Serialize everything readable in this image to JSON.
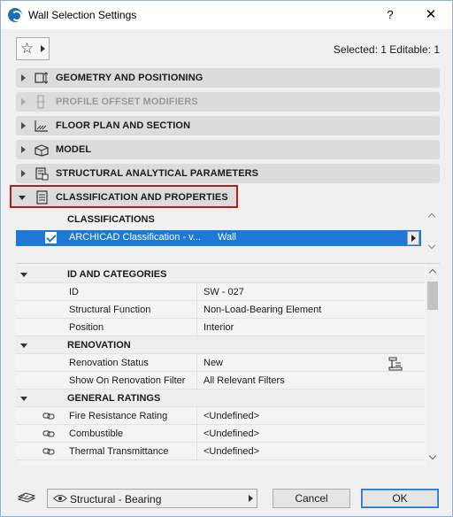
{
  "window": {
    "title": "Wall Selection Settings",
    "help_label": "?",
    "close_label": "✕"
  },
  "toolbar": {
    "selected_info": "Selected: 1 Editable: 1"
  },
  "sections": [
    {
      "label": "GEOMETRY AND POSITIONING",
      "icon": "geometry-icon",
      "disabled": false,
      "open": false
    },
    {
      "label": "PROFILE OFFSET MODIFIERS",
      "icon": "profile-offset-icon",
      "disabled": true,
      "open": false
    },
    {
      "label": "FLOOR PLAN AND SECTION",
      "icon": "floor-plan-icon",
      "disabled": false,
      "open": false
    },
    {
      "label": "MODEL",
      "icon": "model-icon",
      "disabled": false,
      "open": false
    },
    {
      "label": "STRUCTURAL ANALYTICAL PARAMETERS",
      "icon": "structural-analytical-icon",
      "disabled": false,
      "open": false
    },
    {
      "label": "CLASSIFICATION AND PROPERTIES",
      "icon": "classification-icon",
      "disabled": false,
      "open": true
    }
  ],
  "classifications": {
    "header": "CLASSIFICATIONS",
    "row": {
      "checked": true,
      "system": "ARCHICAD Classification - v...",
      "value": "Wall"
    }
  },
  "properties": {
    "groups": [
      {
        "label": "ID AND CATEGORIES",
        "rows": [
          {
            "name": "ID",
            "value": "SW - 027"
          },
          {
            "name": "Structural Function",
            "value": "Non-Load-Bearing Element"
          },
          {
            "name": "Position",
            "value": "Interior"
          }
        ]
      },
      {
        "label": "RENOVATION",
        "rows": [
          {
            "name": "Renovation Status",
            "value": "New"
          },
          {
            "name": "Show On Renovation Filter",
            "value": "All Relevant Filters"
          }
        ]
      },
      {
        "label": "GENERAL RATINGS",
        "rows": [
          {
            "name": "Fire Resistance Rating",
            "value": "<Undefined>"
          },
          {
            "name": "Combustible",
            "value": "<Undefined>"
          },
          {
            "name": "Thermal Transmittance",
            "value": "<Undefined>"
          }
        ]
      }
    ]
  },
  "footer": {
    "layer_combo": "Structural - Bearing",
    "cancel_label": "Cancel",
    "ok_label": "OK"
  },
  "colors": {
    "selection_blue": "#1e78d6",
    "highlight_red": "#b71c1c",
    "section_bg": "#dcdcdc"
  }
}
